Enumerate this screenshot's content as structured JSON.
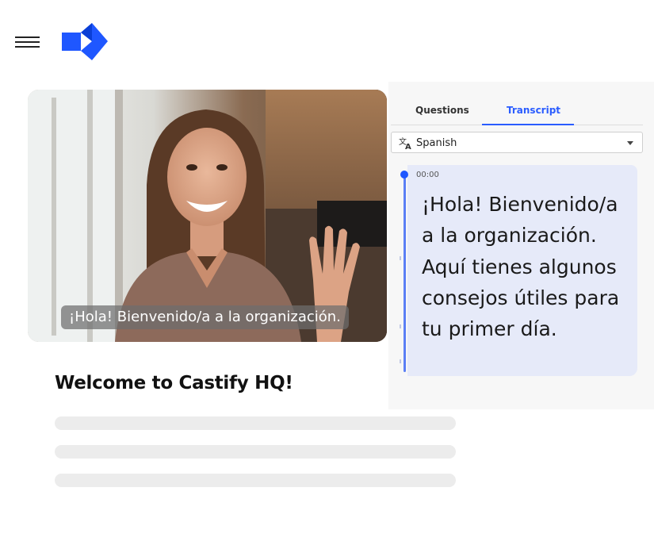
{
  "header": {
    "menu_icon": "hamburger-menu-icon",
    "logo_icon": "castify-play-logo",
    "brand_color": "#1f57ff"
  },
  "video": {
    "caption": "¡Hola! Bienvenido/a a la organización."
  },
  "article": {
    "title": "Welcome to Castify HQ!"
  },
  "panel": {
    "tabs": [
      {
        "label": "Questions",
        "active": false
      },
      {
        "label": "Transcript",
        "active": true
      }
    ],
    "language": {
      "icon": "translate-icon",
      "selected": "Spanish"
    },
    "segments": [
      {
        "time": "00:00",
        "text": "¡Hola! Bienvenido/a a la organización. Aquí tienes algunos consejos útiles para tu primer día."
      }
    ],
    "accent_color": "#2a5cff",
    "segment_bg": "#e6eaf9"
  }
}
